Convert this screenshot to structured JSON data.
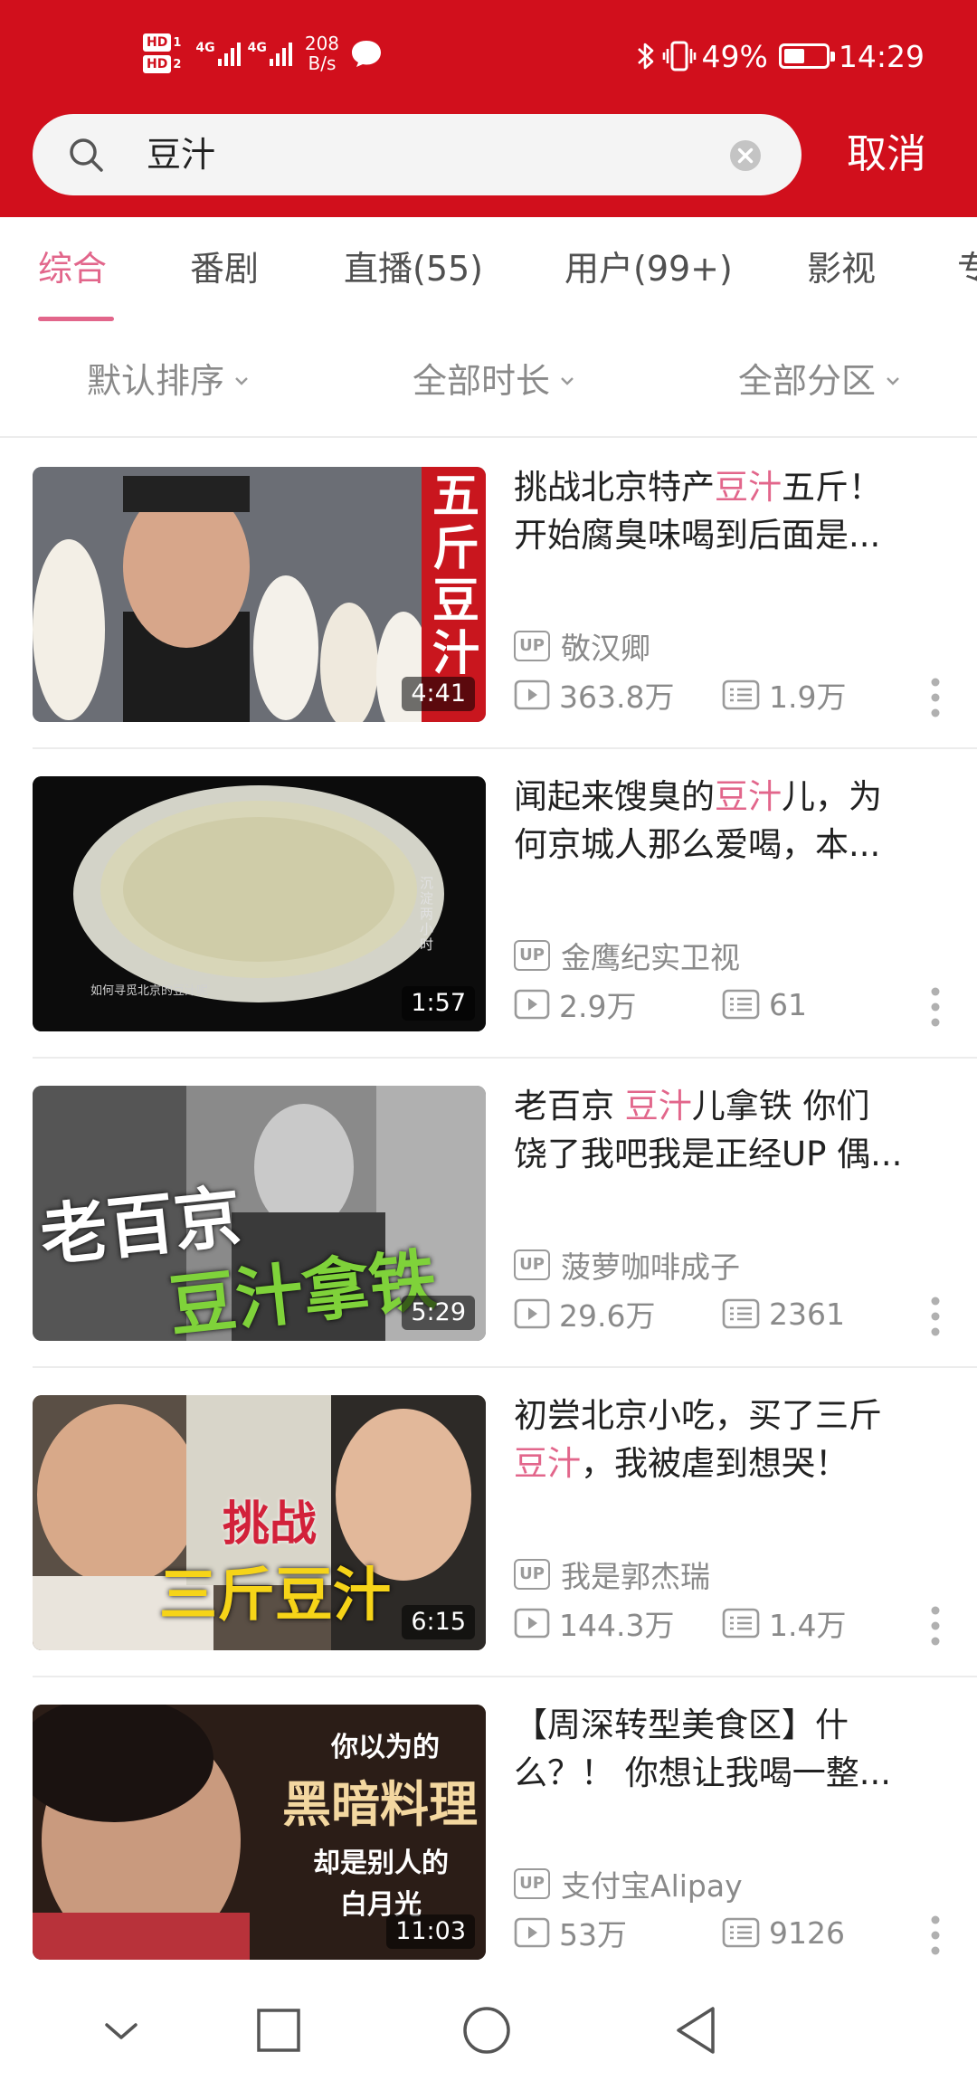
{
  "status_bar": {
    "hd1": "HD",
    "hd1_num": "1",
    "hd2": "HD",
    "hd2_num": "2",
    "sig1_label": "4G",
    "sig2_label": "4G",
    "net_speed_value": "208",
    "net_speed_unit": "B/s",
    "battery_percent": "49%",
    "battery_level": 0.49,
    "time": "14:29",
    "icons": [
      "hd-icon",
      "signal-icon",
      "message-icon",
      "bluetooth-icon",
      "vibrate-icon",
      "battery-icon"
    ]
  },
  "search": {
    "query": "豆汁",
    "cancel_label": "取消"
  },
  "tabs": [
    {
      "label": "综合",
      "active": true
    },
    {
      "label": "番剧"
    },
    {
      "label": "直播(55)"
    },
    {
      "label": "用户(99+)"
    },
    {
      "label": "影视"
    },
    {
      "label": "专"
    }
  ],
  "filters": [
    {
      "label": "默认排序"
    },
    {
      "label": "全部时长"
    },
    {
      "label": "全部分区"
    }
  ],
  "videos": [
    {
      "title_line1_pre": "挑战北京特产",
      "title_line1_hl": "豆汁",
      "title_line1_post": "五斤！",
      "title_line2": "开始腐臭味喝到后面是...",
      "up_badge": "UP",
      "uploader": "敬汉卿",
      "views": "363.8万",
      "danmaku": "1.9万",
      "duration": "4:41",
      "thumb_text": "五斤豆汁"
    },
    {
      "title_line1_pre": "闻起来馊臭的",
      "title_line1_hl": "豆汁",
      "title_line1_post": "儿，为",
      "title_line2": "何京城人那么爱喝，本...",
      "up_badge": "UP",
      "uploader": "金鹰纪实卫视",
      "views": "2.9万",
      "danmaku": "61",
      "duration": "1:57",
      "thumb_caption": "如何寻觅北京的豆汁呢",
      "thumb_vertical": "沉淀两小时"
    },
    {
      "title_line1_pre": "老百京 ",
      "title_line1_hl": "豆汁",
      "title_line1_post": "儿拿铁 你们",
      "title_line2": "饶了我吧我是正经UP 偶...",
      "up_badge": "UP",
      "uploader": "菠萝咖啡成子",
      "views": "29.6万",
      "danmaku": "2361",
      "duration": "5:29",
      "thumb_text1": "老百京",
      "thumb_text2": "豆汁拿铁"
    },
    {
      "title_line1_pre": "初尝北京小吃，买了三斤",
      "title_line1_hl": "",
      "title_line1_post": "",
      "title_line2_hl": "豆汁",
      "title_line2": "，我被虐到想哭！",
      "up_badge": "UP",
      "uploader": "我是郭杰瑞",
      "views": "144.3万",
      "danmaku": "1.4万",
      "duration": "6:15",
      "thumb_text1": "挑战",
      "thumb_text2": "三斤豆汁"
    },
    {
      "title_line1_pre": "【周深转型美食区】什",
      "title_line1_hl": "",
      "title_line1_post": "",
      "title_line2": "么？！ 你想让我喝一整...",
      "up_badge": "UP",
      "uploader": "支付宝Alipay",
      "views": "53万",
      "danmaku": "9126",
      "duration": "11:03",
      "thumb_text1": "你以为的",
      "thumb_text2": "黑暗料理",
      "thumb_text3": "却是别人的",
      "thumb_text4": "白月光"
    }
  ],
  "colors": {
    "header_red": "#d10f1c",
    "accent_pink": "#e2668b",
    "meta_gray": "#8a8a8a"
  },
  "navbar_icons": [
    "back-chevron-icon",
    "recents-square-icon",
    "home-circle-icon",
    "back-triangle-icon"
  ]
}
